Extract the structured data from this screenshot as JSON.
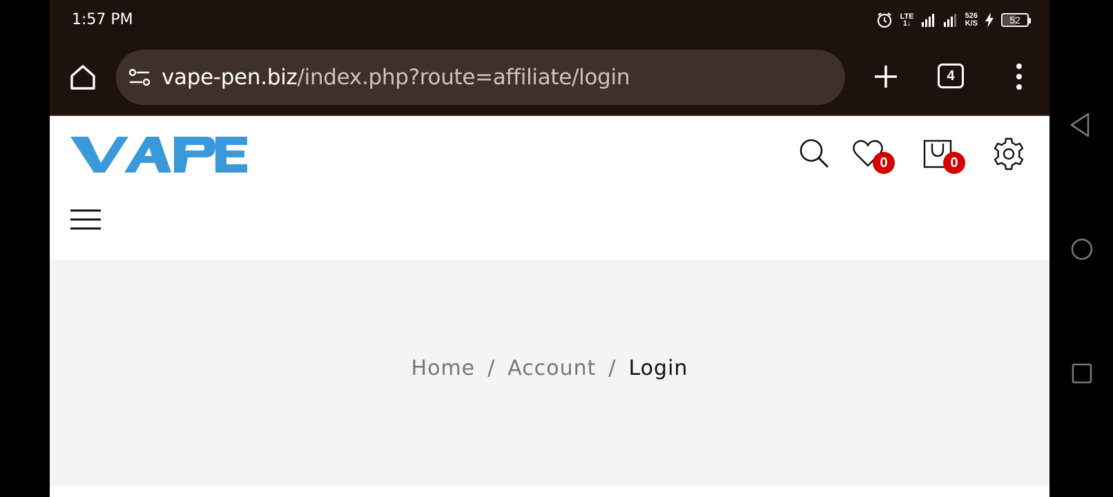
{
  "status_bar": {
    "time": "1:57 PM",
    "network_type": "LTE",
    "network_sub": "1↓",
    "speed_value": "526",
    "speed_unit": "K/S",
    "battery_level": "52"
  },
  "browser": {
    "url_domain": "vape-pen.biz",
    "url_path": "/index.php?route=affiliate/login",
    "tab_count": "4"
  },
  "site": {
    "logo_text": "VAPE",
    "wishlist_count": "0",
    "cart_count": "0"
  },
  "breadcrumb": {
    "items": [
      "Home",
      "Account"
    ],
    "separator": "/",
    "current": "Login"
  },
  "colors": {
    "browser_bg": "#1d120d",
    "urlbar_bg": "#40302a",
    "logo_blue": "#3a9ad9",
    "badge_red": "#d40000",
    "crumb_bg": "#f4f4f4"
  },
  "icons": [
    "home-icon",
    "tune-icon",
    "plus-icon",
    "tabs-icon",
    "more-vert-icon",
    "search-icon",
    "heart-icon",
    "cart-icon",
    "gear-icon",
    "menu-icon",
    "back-icon",
    "circle-icon",
    "square-icon"
  ]
}
